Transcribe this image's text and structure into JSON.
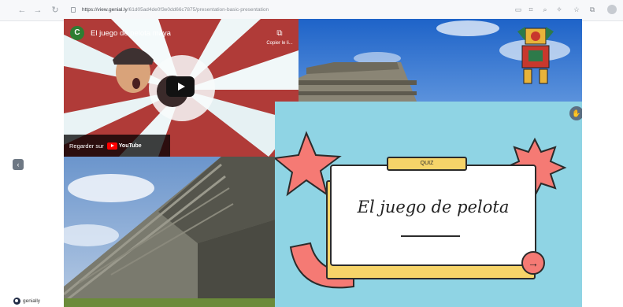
{
  "browser": {
    "url_host": "https://view.genial.ly",
    "url_path": "/61d05ad4de0f3e0dd66c7875/presentation-basic-presentation",
    "nav_back": "←",
    "nav_forward": "→",
    "nav_reload": "↻"
  },
  "video": {
    "channel_initial": "C",
    "title": "El juego de pelota maya",
    "copy_label": "Copier le li...",
    "watch_on": "Regarder sur",
    "platform": "YouTube"
  },
  "slide": {
    "quiz_label": "QUIZ",
    "title": "El juego de pelota",
    "next_icon": "→"
  },
  "app": {
    "logo": "genially",
    "left_nav": "‹"
  },
  "colors": {
    "slide_bg": "#8fd4e4",
    "accent_coral": "#f57a74",
    "accent_yellow": "#f6d469"
  }
}
